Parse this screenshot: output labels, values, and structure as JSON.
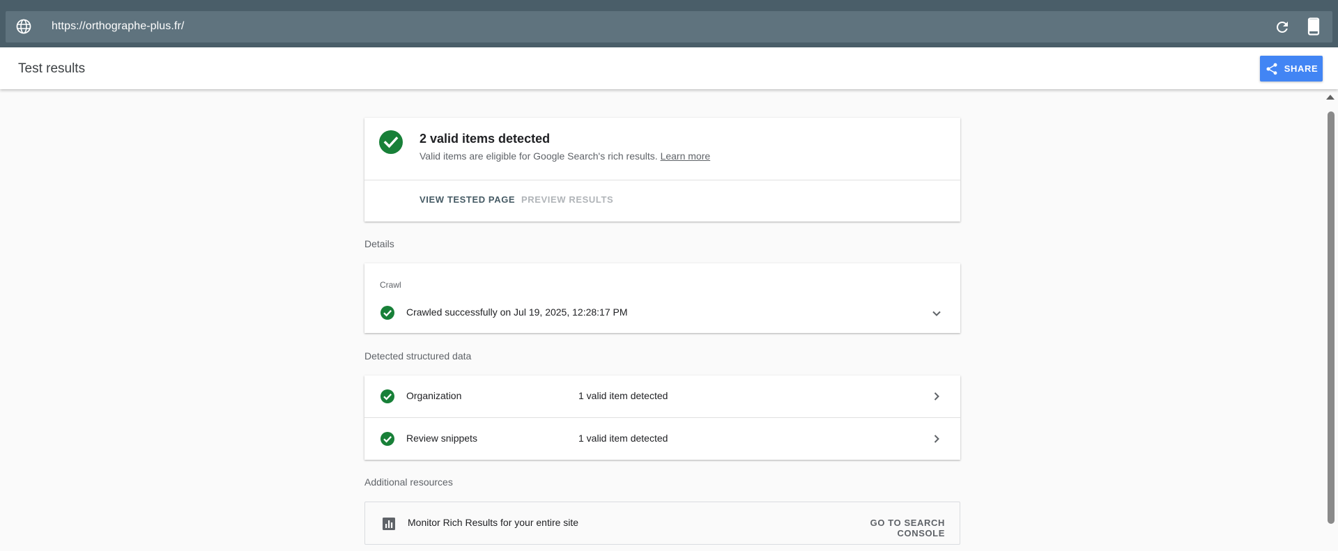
{
  "urlbar": {
    "url": "https://orthographe-plus.fr/",
    "icons": {
      "site": "globe-icon",
      "reload": "reload-icon",
      "device": "smartphone-icon"
    }
  },
  "header": {
    "title": "Test results",
    "share_label": "SHARE",
    "share_icon": "share-icon"
  },
  "summary": {
    "title": "2 valid items detected",
    "description": "Valid items are eligible for Google Search's rich results.",
    "learn_more": "Learn more",
    "view_tested_page": "VIEW TESTED PAGE",
    "preview_results": "PREVIEW RESULTS"
  },
  "details": {
    "section_label": "Details",
    "crawl_label": "Crawl",
    "crawl_status": "Crawled successfully on Jul 19, 2025, 12:28:17 PM"
  },
  "structured_data": {
    "section_label": "Detected structured data",
    "items": [
      {
        "name": "Organization",
        "count": "1 valid item detected"
      },
      {
        "name": "Review snippets",
        "count": "1 valid item detected"
      }
    ]
  },
  "resources": {
    "section_label": "Additional resources",
    "text": "Monitor Rich Results for your entire site",
    "button": "GO TO SEARCH CONSOLE"
  },
  "colors": {
    "valid_green": "#188038",
    "share_blue": "#4285f4",
    "urlbar_bg": "#5f737e"
  }
}
